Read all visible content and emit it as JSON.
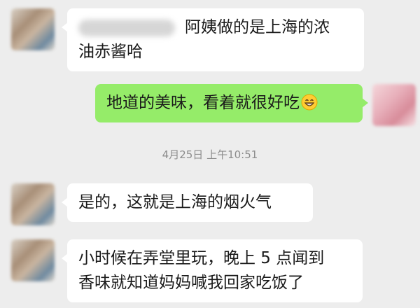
{
  "messages": [
    {
      "sender": "other",
      "name_redacted": true,
      "text_line1": "阿姨做的是上海的浓",
      "text_line2": "油赤酱哈"
    },
    {
      "sender": "me",
      "text": "地道的美味，看着就很好吃",
      "emoji": "grin-emoji"
    },
    {
      "type": "timestamp",
      "text": "4月25日 上午10:51"
    },
    {
      "sender": "other",
      "text": "是的，这就是上海的烟火气"
    },
    {
      "sender": "other",
      "text_line1": "小时候在弄堂里玩，晚上 5 点闻到",
      "text_line2": "香味就知道妈妈喊我回家吃饭了"
    }
  ],
  "colors": {
    "background": "#ededed",
    "bubble_in": "#ffffff",
    "bubble_out": "#95ec69",
    "timestamp_text": "#8c8c8c"
  }
}
